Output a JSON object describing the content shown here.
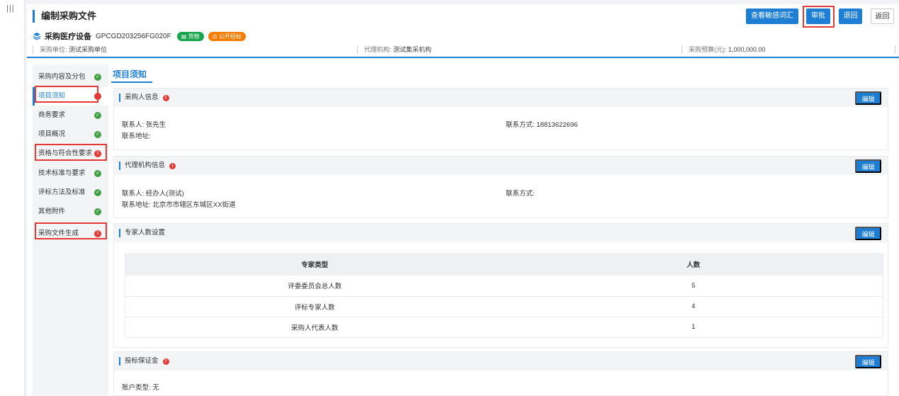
{
  "header": {
    "title": "编制采购文件",
    "buttons": {
      "sensitive_words": "查看敏感词汇",
      "approve": "审批",
      "return": "退回",
      "back": "返回"
    },
    "project": {
      "name": "采购医疗设备",
      "code": "GPCGD203256FG020F",
      "tags": [
        "货物",
        "公开招标"
      ]
    },
    "meta": {
      "unit_label": "采购单位:",
      "unit_value": "测试采购单位",
      "agency_label": "代理机构:",
      "agency_value": "测试集采机构",
      "budget_label": "采购预算(元):",
      "budget_value": "1,000,000.00"
    }
  },
  "nav": {
    "items": [
      {
        "label": "采购内容及分包",
        "status": "ok"
      },
      {
        "label": "项目须知",
        "status": "error"
      },
      {
        "label": "商务要求",
        "status": "ok"
      },
      {
        "label": "项目概况",
        "status": "ok"
      },
      {
        "label": "资格与符合性要求",
        "status": "error"
      },
      {
        "label": "技术标准与要求",
        "status": "ok"
      },
      {
        "label": "评标方法及标准",
        "status": "ok"
      },
      {
        "label": "其他附件",
        "status": "ok"
      },
      {
        "label": "采购文件生成",
        "status": "error"
      }
    ]
  },
  "content": {
    "section_title": "项目须知",
    "edit_label": "编辑",
    "purchaser": {
      "title": "采购人信息",
      "contact_label": "联系人:",
      "contact_value": "张先生",
      "phone_label": "联系方式:",
      "phone_value": "18813622696",
      "address_label": "联系地址:",
      "address_value": ""
    },
    "agency": {
      "title": "代理机构信息",
      "contact_label": "联系人:",
      "contact_value": "经办人(测试)",
      "phone_label": "联系方式:",
      "phone_value": "",
      "address_label": "联系地址:",
      "address_value": "北京市市辖区东城区XX街道"
    },
    "experts": {
      "title": "专家人数设置",
      "columns": [
        "专家类型",
        "人数"
      ],
      "rows": [
        [
          "评委委员会总人数",
          "5"
        ],
        [
          "评标专家人数",
          "4"
        ],
        [
          "采购人代表人数",
          "1"
        ]
      ]
    },
    "deposit": {
      "title": "投标保证金",
      "account_label": "账户类型:",
      "account_value": "无"
    }
  },
  "colors": {
    "primary": "#1e7ed4",
    "success": "#43a047",
    "error": "#e53935",
    "highlight": "#e53935"
  }
}
